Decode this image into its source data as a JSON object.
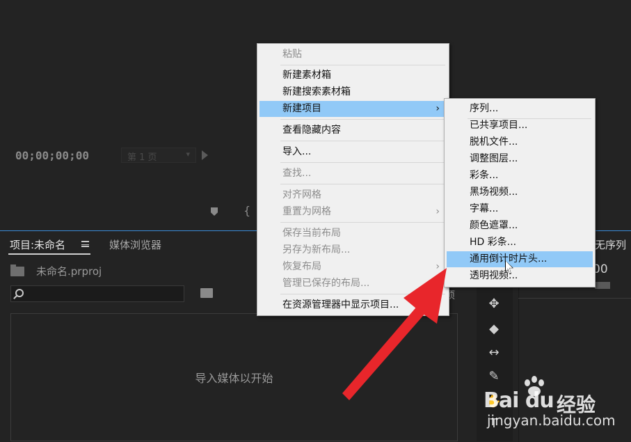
{
  "monitor": {
    "timecode": "00;00;00;00",
    "page_select": "第 1 页"
  },
  "project_panel": {
    "tab_project": "项目:未命名",
    "tab_media": "媒体浏览器",
    "project_file": "未命名.prproj",
    "search_placeholder": "",
    "drop_hint": "导入媒体以开始",
    "partial_item": "项"
  },
  "sequence_panel": {
    "tab": "无序列",
    "timecode": "00"
  },
  "context_menu": {
    "items": [
      {
        "label": "粘贴",
        "disabled": true
      },
      {
        "label": "新建素材箱",
        "disabled": false
      },
      {
        "label": "新建搜索素材箱",
        "disabled": false
      },
      {
        "label": "新建项目",
        "disabled": false,
        "submenu": true,
        "highlighted": true
      },
      {
        "label": "查看隐藏内容",
        "disabled": false
      },
      {
        "label": "导入...",
        "disabled": false
      },
      {
        "label": "查找...",
        "disabled": true
      },
      {
        "label": "对齐网格",
        "disabled": true
      },
      {
        "label": "重置为网格",
        "disabled": true,
        "submenu": true
      },
      {
        "label": "保存当前布局",
        "disabled": true
      },
      {
        "label": "另存为新布局...",
        "disabled": true
      },
      {
        "label": "恢复布局",
        "disabled": true,
        "submenu": true
      },
      {
        "label": "管理已保存的布局...",
        "disabled": true
      },
      {
        "label": "在资源管理器中显示项目...",
        "disabled": false
      }
    ]
  },
  "submenu": {
    "items": [
      {
        "label": "序列..."
      },
      {
        "label": "已共享项目..."
      },
      {
        "label": "脱机文件..."
      },
      {
        "label": "调整图层..."
      },
      {
        "label": "彩条..."
      },
      {
        "label": "黑场视频..."
      },
      {
        "label": "字幕..."
      },
      {
        "label": "颜色遮罩..."
      },
      {
        "label": "HD 彩条..."
      },
      {
        "label": "通用倒计时片头...",
        "highlighted": true
      },
      {
        "label": "透明视频..."
      }
    ]
  },
  "watermark": {
    "logo": "Bai du",
    "cn": "经验",
    "url": "jingyan.baidu.com"
  },
  "colors": {
    "highlight": "#91c9f7",
    "menu_bg": "#f0f0f0",
    "annotation_arrow": "#e8262b",
    "panel_accent": "#3a8bd8"
  }
}
